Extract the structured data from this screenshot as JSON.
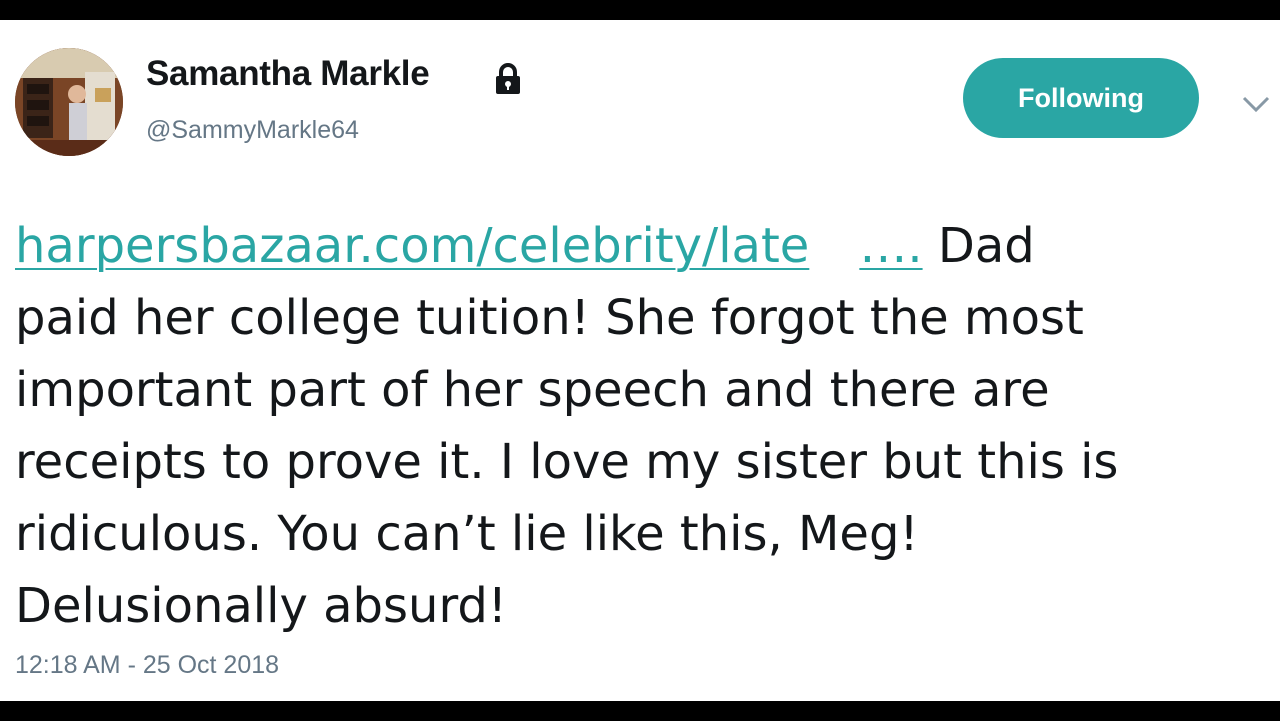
{
  "tweet": {
    "author": {
      "display_name": "Samantha Markle",
      "handle": "@SammyMarkle64",
      "protected_icon": "lock-icon",
      "avatar": "profile-photo"
    },
    "follow_button_label": "Following",
    "menu_icon": "chevron-down-icon",
    "link_text": "harpersbazaar.com/celebrity/late",
    "link_ellipsis": "….",
    "text_lines": [
      "Dad",
      "paid her college tuition! She forgot the most",
      "important part of her speech and there are",
      "receipts to prove it. I love my sister but this is",
      "ridiculous. You can’t lie like this, Meg!",
      "Delusionally absurd!"
    ],
    "timestamp": "12:18 AM - 25 Oct 2018"
  },
  "colors": {
    "accent": "#2aa6a4",
    "text": "#14171a",
    "secondary_text": "#657786",
    "letterbox": "#000000"
  }
}
